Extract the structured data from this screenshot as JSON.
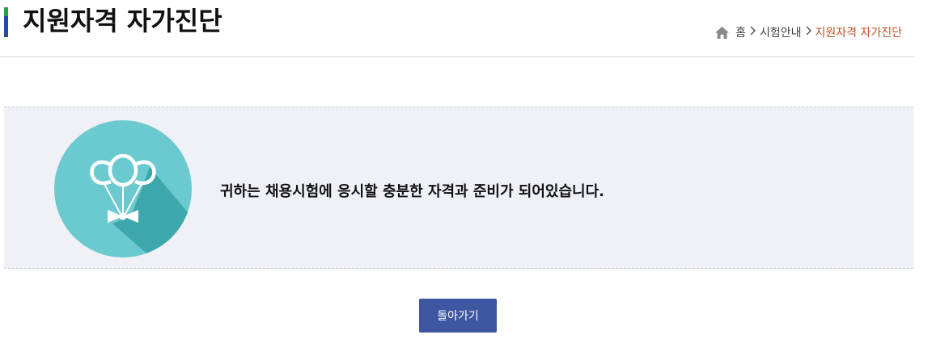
{
  "header": {
    "title": "지원자격 자가진단"
  },
  "breadcrumb": {
    "home_icon": "home-icon",
    "items": [
      "홈",
      "시험안내",
      "지원자격 자가진단"
    ]
  },
  "result": {
    "icon": "balloons-icon",
    "message": "귀하는 채용시험에 응시할 충분한 자격과 준비가 되어있습니다."
  },
  "actions": {
    "back_label": "돌아가기"
  },
  "colors": {
    "accent": "#3f57a0",
    "title_bar_top": "#2e9d3d",
    "title_bar_bottom": "#1f4fa3",
    "breadcrumb_current": "#c0501f",
    "result_background": "#eff1f6",
    "icon_circle": "#6bc9d0"
  }
}
